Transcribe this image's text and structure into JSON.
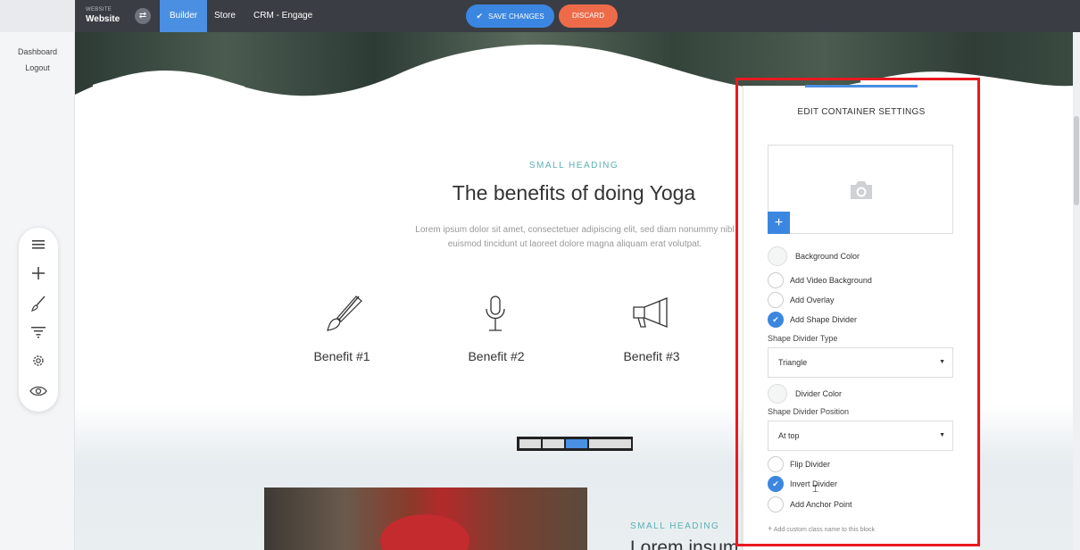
{
  "topbar": {
    "site_label_small": "WEBSITE",
    "site_name": "Website",
    "tabs": [
      "Builder",
      "Store",
      "CRM - Engage"
    ],
    "save_label": "SAVE CHANGES",
    "discard_label": "DISCARD"
  },
  "left_panel": {
    "links": [
      "Dashboard",
      "Logout"
    ],
    "tools": [
      "menu-icon",
      "plus-icon",
      "brush-icon",
      "filter-icon",
      "gear-icon",
      "eye-icon"
    ]
  },
  "page": {
    "small_heading": "SMALL HEADING",
    "heading": "The benefits of doing Yoga",
    "lorem_line1": "Lorem ipsum dolor sit amet, consectetuer adipiscing elit, sed diam nonummy nibl",
    "lorem_line2": "euismod tincidunt ut laoreet dolore magna aliquam erat volutpat.",
    "benefits": [
      "Benefit #1",
      "Benefit #2",
      "Benefit #3"
    ],
    "small_heading_2": "SMALL HEADING",
    "heading_2": "Lorem insum"
  },
  "settings": {
    "title": "EDIT CONTAINER SETTINGS",
    "background_color_label": "Background Color",
    "options": [
      {
        "label": "Add Video Background",
        "checked": false
      },
      {
        "label": "Add Overlay",
        "checked": false
      },
      {
        "label": "Add Shape Divider",
        "checked": true
      }
    ],
    "shape_divider_type_label": "Shape Divider Type",
    "shape_divider_type_value": "Triangle",
    "divider_color_label": "Divider Color",
    "shape_divider_position_label": "Shape Divider Position",
    "shape_divider_position_value": "At top",
    "options_2": [
      {
        "label": "Flip Divider",
        "checked": false
      },
      {
        "label": "Invert Divider",
        "checked": true
      },
      {
        "label": "Add Anchor Point",
        "checked": false
      }
    ],
    "add_class_label": "Add custom class name to this block"
  },
  "colors": {
    "accent_blue": "#3b86e0",
    "discard_orange": "#ee6b4a",
    "teal_heading": "#5ab0b4",
    "highlight_red": "#e8191f"
  }
}
